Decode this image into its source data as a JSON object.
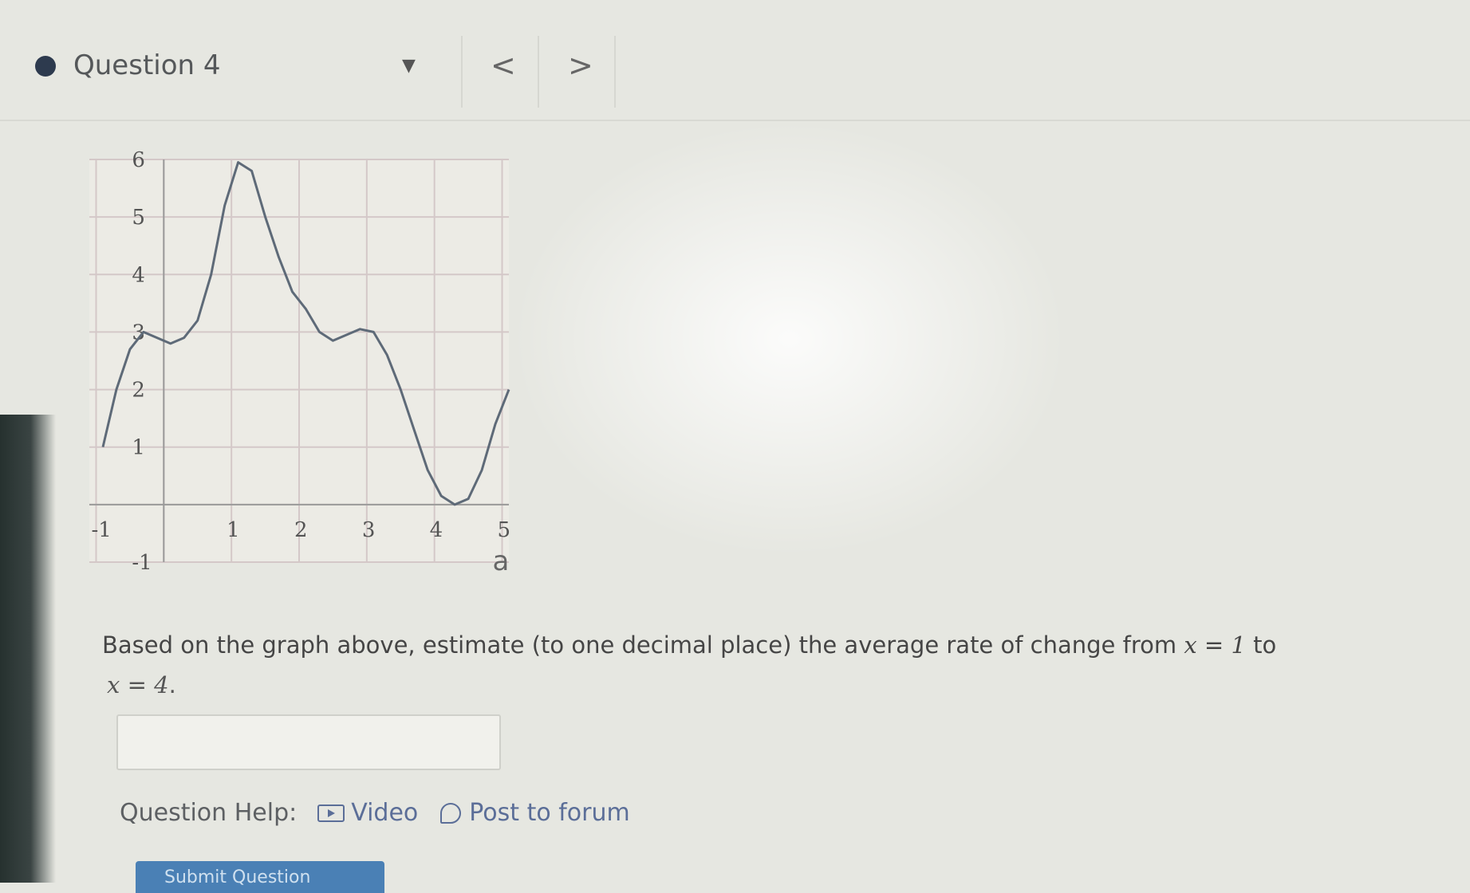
{
  "header": {
    "question_title": "Question 4",
    "dropdown_icon": "caret-down-icon",
    "prev_label": "<",
    "next_label": ">"
  },
  "chart_data": {
    "type": "line",
    "x_ticks": [
      "-1",
      "1",
      "2",
      "3",
      "4",
      "5"
    ],
    "y_ticks": [
      "-1",
      "1",
      "2",
      "3",
      "4",
      "5",
      "6"
    ],
    "xlim": [
      -1.1,
      5.1
    ],
    "ylim": [
      -1,
      6
    ],
    "grid": true,
    "series": [
      {
        "x": [
          -0.9,
          -0.7,
          -0.5,
          -0.3,
          -0.1,
          0.1,
          0.3,
          0.5,
          0.7,
          0.9,
          1.1,
          1.3,
          1.5,
          1.7,
          1.9,
          2.1,
          2.3,
          2.5,
          2.7,
          2.9,
          3.1,
          3.3,
          3.5,
          3.7,
          3.9,
          4.1,
          4.3,
          4.5,
          4.7,
          4.9,
          5.1
        ],
        "y": [
          1.0,
          2.0,
          2.7,
          3.0,
          2.9,
          2.8,
          2.9,
          3.2,
          4.0,
          5.2,
          5.95,
          5.8,
          5.0,
          4.3,
          3.7,
          3.4,
          3.0,
          2.85,
          2.95,
          3.05,
          3.0,
          2.6,
          2.0,
          1.3,
          0.6,
          0.15,
          0.0,
          0.1,
          0.6,
          1.4,
          2.0
        ]
      }
    ],
    "annotation": "a"
  },
  "question": {
    "text_before": "Based on the graph above, estimate (to one decimal place) the average rate of change from ",
    "x_var": "x",
    "eq": " = ",
    "from_val": "1",
    "to_word": " to",
    "to_val": "4",
    "end_period": "."
  },
  "answer": {
    "value": ""
  },
  "help": {
    "label": "Question Help:",
    "video_label": "Video",
    "forum_label": "Post to forum"
  },
  "submit": {
    "label": "Submit Question"
  }
}
